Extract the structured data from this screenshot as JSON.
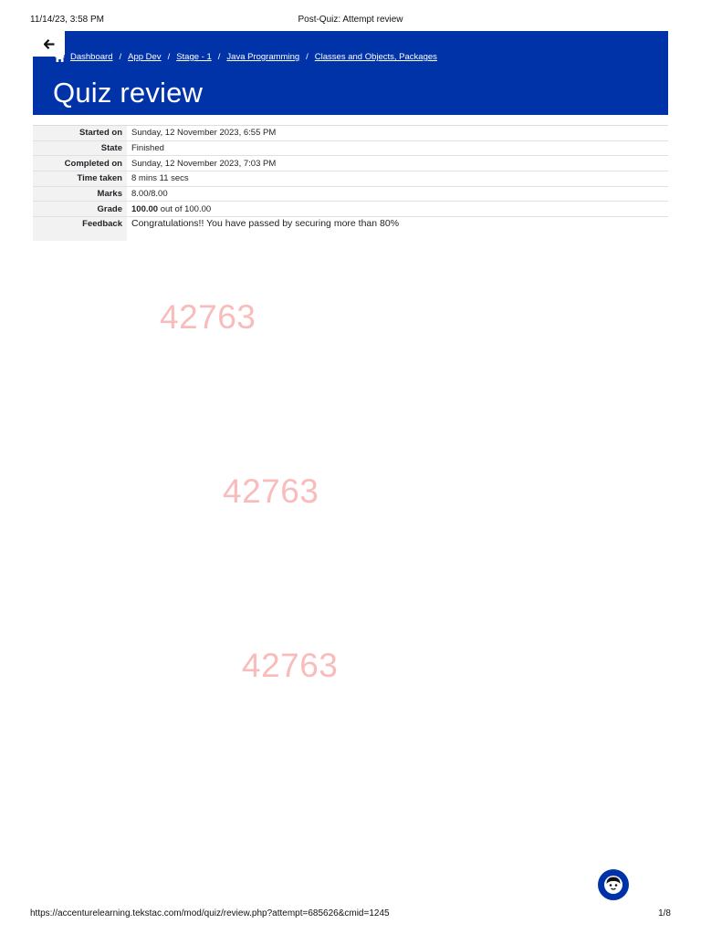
{
  "print_header": {
    "datetime": "11/14/23, 3:58 PM",
    "document_title": "Post-Quiz: Attempt review"
  },
  "banner": {
    "background_color": "#0033a8",
    "breadcrumb": [
      "Dashboard",
      "App Dev",
      "Stage - 1",
      "Java Programming",
      "Classes and Objects, Packages"
    ],
    "separator": "/",
    "title": "Quiz review"
  },
  "summary": {
    "started_on": {
      "label": "Started on",
      "value": "Sunday, 12 November 2023, 6:55 PM"
    },
    "state": {
      "label": "State",
      "value": "Finished"
    },
    "completed_on": {
      "label": "Completed on",
      "value": "Sunday, 12 November 2023, 7:03 PM"
    },
    "time_taken": {
      "label": "Time taken",
      "value": "8 mins 11 secs"
    },
    "marks": {
      "label": "Marks",
      "value": "8.00/8.00"
    },
    "grade": {
      "label": "Grade",
      "value_bold": "100.00",
      "value_rest": " out of 100.00"
    },
    "feedback": {
      "label": "Feedback",
      "value": "Congratulations!! You have passed by securing more than 80%"
    }
  },
  "watermarks": [
    "42763",
    "42763",
    "42763"
  ],
  "icons": {
    "back": "arrow-left-icon",
    "home": "home-icon",
    "chat": "chat-avatar-icon"
  },
  "print_footer": {
    "url": "https://accenturelearning.tekstac.com/mod/quiz/review.php?attempt=685626&cmid=1245",
    "page": "1/8"
  }
}
